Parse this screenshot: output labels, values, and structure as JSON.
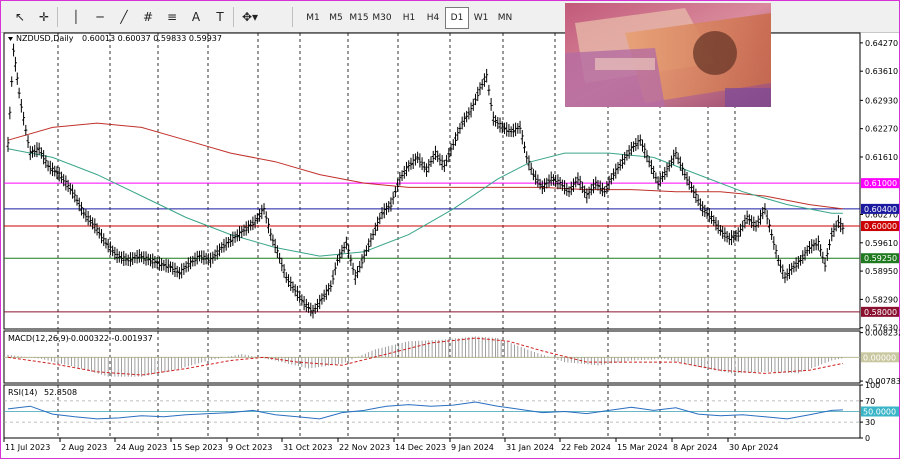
{
  "toolbar": {
    "tools": [
      {
        "name": "cursor-tool",
        "glyph": "↖"
      },
      {
        "name": "crosshair-tool",
        "glyph": "✛"
      },
      {
        "name": "vertical-line-tool",
        "glyph": "│"
      },
      {
        "name": "horizontal-line-tool",
        "glyph": "─"
      },
      {
        "name": "trendline-tool",
        "glyph": "╱"
      },
      {
        "name": "channel-tool",
        "glyph": "#"
      },
      {
        "name": "fibonacci-tool",
        "glyph": "≡"
      },
      {
        "name": "text-tool",
        "glyph": "A"
      },
      {
        "name": "text-label-tool",
        "glyph": "T"
      },
      {
        "name": "shapes-tool",
        "glyph": "✥▾"
      }
    ],
    "timeframes": [
      "M1",
      "M5",
      "M15",
      "M30",
      "H1",
      "H4",
      "D1",
      "W1",
      "MN"
    ],
    "active_timeframe": "D1"
  },
  "chart_data": [
    {
      "type": "line",
      "title": "NZDUSD,Daily",
      "ohlc": "0.60013 0.60037 0.59833 0.59937",
      "ylim": [
        0.576,
        0.645
      ],
      "price_ticks": [
        "0.64270",
        "0.63610",
        "0.62930",
        "0.62270",
        "0.61610",
        "0.60270",
        "0.59610",
        "0.58950",
        "0.58290",
        "0.57630"
      ],
      "date_ticks": [
        "11 Jul 2023",
        "2 Aug 2023",
        "24 Aug 2023",
        "15 Sep 2023",
        "9 Oct 2023",
        "31 Oct 2023",
        "22 Nov 2023",
        "14 Dec 2023",
        "9 Jan 2024",
        "31 Jan 2024",
        "22 Feb 2024",
        "15 Mar 2024",
        "8 Apr 2024",
        "30 Apr 2024"
      ],
      "levels": [
        {
          "price": 0.61,
          "label": "0.61000",
          "color": "#ff00ff"
        },
        {
          "price": 0.604,
          "label": "0.60400",
          "color": "#1a1aa0"
        },
        {
          "price": 0.6,
          "label": "0.60000",
          "color": "#cc0000"
        },
        {
          "price": 0.5925,
          "label": "0.59250",
          "color": "#1f7a1f"
        },
        {
          "price": 0.58,
          "label": "0.58000",
          "color": "#8a1030"
        }
      ],
      "close_series": [
        [
          0,
          0.619
        ],
        [
          5,
          0.641
        ],
        [
          10,
          0.631
        ],
        [
          14,
          0.625
        ],
        [
          20,
          0.617
        ],
        [
          28,
          0.618
        ],
        [
          36,
          0.614
        ],
        [
          46,
          0.612
        ],
        [
          58,
          0.608
        ],
        [
          68,
          0.603
        ],
        [
          78,
          0.6
        ],
        [
          88,
          0.596
        ],
        [
          98,
          0.593
        ],
        [
          108,
          0.592
        ],
        [
          118,
          0.593
        ],
        [
          128,
          0.592
        ],
        [
          138,
          0.591
        ],
        [
          146,
          0.5905
        ],
        [
          154,
          0.589
        ],
        [
          162,
          0.591
        ],
        [
          172,
          0.593
        ],
        [
          182,
          0.592
        ],
        [
          192,
          0.595
        ],
        [
          202,
          0.597
        ],
        [
          212,
          0.599
        ],
        [
          222,
          0.601
        ],
        [
          230,
          0.604
        ],
        [
          236,
          0.598
        ],
        [
          242,
          0.594
        ],
        [
          250,
          0.588
        ],
        [
          258,
          0.585
        ],
        [
          266,
          0.582
        ],
        [
          274,
          0.58
        ],
        [
          282,
          0.583
        ],
        [
          290,
          0.586
        ],
        [
          296,
          0.592
        ],
        [
          304,
          0.596
        ],
        [
          312,
          0.588
        ],
        [
          320,
          0.593
        ],
        [
          328,
          0.598
        ],
        [
          336,
          0.603
        ],
        [
          344,
          0.605
        ],
        [
          352,
          0.611
        ],
        [
          360,
          0.614
        ],
        [
          368,
          0.616
        ],
        [
          376,
          0.613
        ],
        [
          384,
          0.617
        ],
        [
          392,
          0.614
        ],
        [
          400,
          0.619
        ],
        [
          408,
          0.624
        ],
        [
          416,
          0.627
        ],
        [
          424,
          0.632
        ],
        [
          430,
          0.635
        ],
        [
          436,
          0.625
        ],
        [
          444,
          0.623
        ],
        [
          452,
          0.622
        ],
        [
          460,
          0.623
        ],
        [
          466,
          0.616
        ],
        [
          472,
          0.612
        ],
        [
          480,
          0.609
        ],
        [
          488,
          0.611
        ],
        [
          496,
          0.61
        ],
        [
          504,
          0.608
        ],
        [
          512,
          0.611
        ],
        [
          520,
          0.607
        ],
        [
          528,
          0.61
        ],
        [
          536,
          0.608
        ],
        [
          544,
          0.612
        ],
        [
          552,
          0.615
        ],
        [
          560,
          0.618
        ],
        [
          568,
          0.62
        ],
        [
          576,
          0.615
        ],
        [
          584,
          0.61
        ],
        [
          592,
          0.613
        ],
        [
          600,
          0.617
        ],
        [
          608,
          0.612
        ],
        [
          616,
          0.608
        ],
        [
          624,
          0.604
        ],
        [
          632,
          0.602
        ],
        [
          640,
          0.599
        ],
        [
          648,
          0.597
        ],
        [
          656,
          0.598
        ],
        [
          664,
          0.602
        ],
        [
          672,
          0.6
        ],
        [
          680,
          0.604
        ],
        [
          686,
          0.598
        ],
        [
          692,
          0.592
        ],
        [
          698,
          0.588
        ],
        [
          704,
          0.59
        ],
        [
          712,
          0.592
        ],
        [
          720,
          0.595
        ],
        [
          728,
          0.596
        ],
        [
          734,
          0.591
        ],
        [
          740,
          0.598
        ],
        [
          746,
          0.601
        ],
        [
          750,
          0.5994
        ]
      ],
      "green_ma": [
        [
          0,
          0.618
        ],
        [
          40,
          0.616
        ],
        [
          80,
          0.612
        ],
        [
          120,
          0.607
        ],
        [
          160,
          0.602
        ],
        [
          200,
          0.598
        ],
        [
          240,
          0.595
        ],
        [
          280,
          0.593
        ],
        [
          320,
          0.594
        ],
        [
          360,
          0.598
        ],
        [
          400,
          0.604
        ],
        [
          440,
          0.611
        ],
        [
          470,
          0.615
        ],
        [
          500,
          0.617
        ],
        [
          540,
          0.617
        ],
        [
          580,
          0.616
        ],
        [
          620,
          0.612
        ],
        [
          660,
          0.608
        ],
        [
          700,
          0.605
        ],
        [
          740,
          0.603
        ],
        [
          750,
          0.603
        ]
      ],
      "red_ma": [
        [
          0,
          0.62
        ],
        [
          40,
          0.623
        ],
        [
          80,
          0.624
        ],
        [
          120,
          0.623
        ],
        [
          160,
          0.62
        ],
        [
          200,
          0.617
        ],
        [
          240,
          0.615
        ],
        [
          280,
          0.612
        ],
        [
          320,
          0.61
        ],
        [
          360,
          0.609
        ],
        [
          400,
          0.609
        ],
        [
          440,
          0.609
        ],
        [
          480,
          0.609
        ],
        [
          520,
          0.6085
        ],
        [
          560,
          0.6085
        ],
        [
          600,
          0.608
        ],
        [
          640,
          0.608
        ],
        [
          680,
          0.607
        ],
        [
          720,
          0.605
        ],
        [
          750,
          0.604
        ]
      ]
    },
    {
      "type": "bar",
      "title": "MACD(12,26,9)",
      "values_text": "-0.000322 -0.001937",
      "ylim": [
        -0.008,
        0.0082
      ],
      "ticks": [
        "0.008232",
        "0.00000",
        "-0.007836"
      ],
      "zero_label": "0.00000",
      "histogram": [
        [
          0,
          0.0008
        ],
        [
          30,
          -0.0005
        ],
        [
          60,
          -0.003
        ],
        [
          90,
          -0.006
        ],
        [
          120,
          -0.006
        ],
        [
          150,
          -0.004
        ],
        [
          180,
          -0.001
        ],
        [
          210,
          0.001
        ],
        [
          240,
          -0.001
        ],
        [
          270,
          -0.0035
        ],
        [
          300,
          -0.002
        ],
        [
          330,
          0.0025
        ],
        [
          360,
          0.005
        ],
        [
          390,
          0.0055
        ],
        [
          420,
          0.0065
        ],
        [
          440,
          0.006
        ],
        [
          470,
          0.002
        ],
        [
          500,
          -0.0015
        ],
        [
          530,
          -0.0025
        ],
        [
          560,
          -0.001
        ],
        [
          590,
          -0.0005
        ],
        [
          620,
          -0.003
        ],
        [
          650,
          -0.005
        ],
        [
          680,
          -0.0045
        ],
        [
          710,
          -0.005
        ],
        [
          740,
          -0.001
        ],
        [
          750,
          -0.0003
        ]
      ],
      "signal": [
        [
          0,
          0.0
        ],
        [
          40,
          -0.002
        ],
        [
          80,
          -0.0045
        ],
        [
          120,
          -0.0055
        ],
        [
          160,
          -0.0035
        ],
        [
          200,
          -0.001
        ],
        [
          230,
          0.0
        ],
        [
          260,
          -0.0015
        ],
        [
          300,
          -0.0025
        ],
        [
          340,
          0.001
        ],
        [
          380,
          0.0045
        ],
        [
          420,
          0.006
        ],
        [
          450,
          0.005
        ],
        [
          480,
          0.002
        ],
        [
          520,
          -0.0015
        ],
        [
          560,
          -0.0015
        ],
        [
          600,
          -0.0015
        ],
        [
          640,
          -0.004
        ],
        [
          680,
          -0.005
        ],
        [
          720,
          -0.004
        ],
        [
          750,
          -0.0019
        ]
      ]
    },
    {
      "type": "line",
      "title": "RSI(14)",
      "value_text": "52.8508",
      "ylim": [
        0,
        100
      ],
      "ticks": [
        "100",
        "70",
        "50.0000",
        "30",
        "0"
      ],
      "level_label": "50.0000",
      "rsi": [
        [
          0,
          55
        ],
        [
          20,
          60
        ],
        [
          40,
          45
        ],
        [
          60,
          40
        ],
        [
          80,
          36
        ],
        [
          100,
          38
        ],
        [
          120,
          42
        ],
        [
          140,
          40
        ],
        [
          160,
          44
        ],
        [
          180,
          46
        ],
        [
          200,
          48
        ],
        [
          220,
          52
        ],
        [
          240,
          44
        ],
        [
          260,
          40
        ],
        [
          280,
          36
        ],
        [
          300,
          48
        ],
        [
          320,
          52
        ],
        [
          340,
          60
        ],
        [
          360,
          63
        ],
        [
          380,
          60
        ],
        [
          400,
          62
        ],
        [
          420,
          68
        ],
        [
          440,
          60
        ],
        [
          460,
          54
        ],
        [
          480,
          48
        ],
        [
          500,
          50
        ],
        [
          520,
          46
        ],
        [
          540,
          52
        ],
        [
          560,
          58
        ],
        [
          580,
          52
        ],
        [
          600,
          57
        ],
        [
          620,
          45
        ],
        [
          640,
          42
        ],
        [
          660,
          44
        ],
        [
          680,
          40
        ],
        [
          700,
          36
        ],
        [
          720,
          44
        ],
        [
          740,
          52
        ],
        [
          750,
          53
        ]
      ]
    }
  ]
}
